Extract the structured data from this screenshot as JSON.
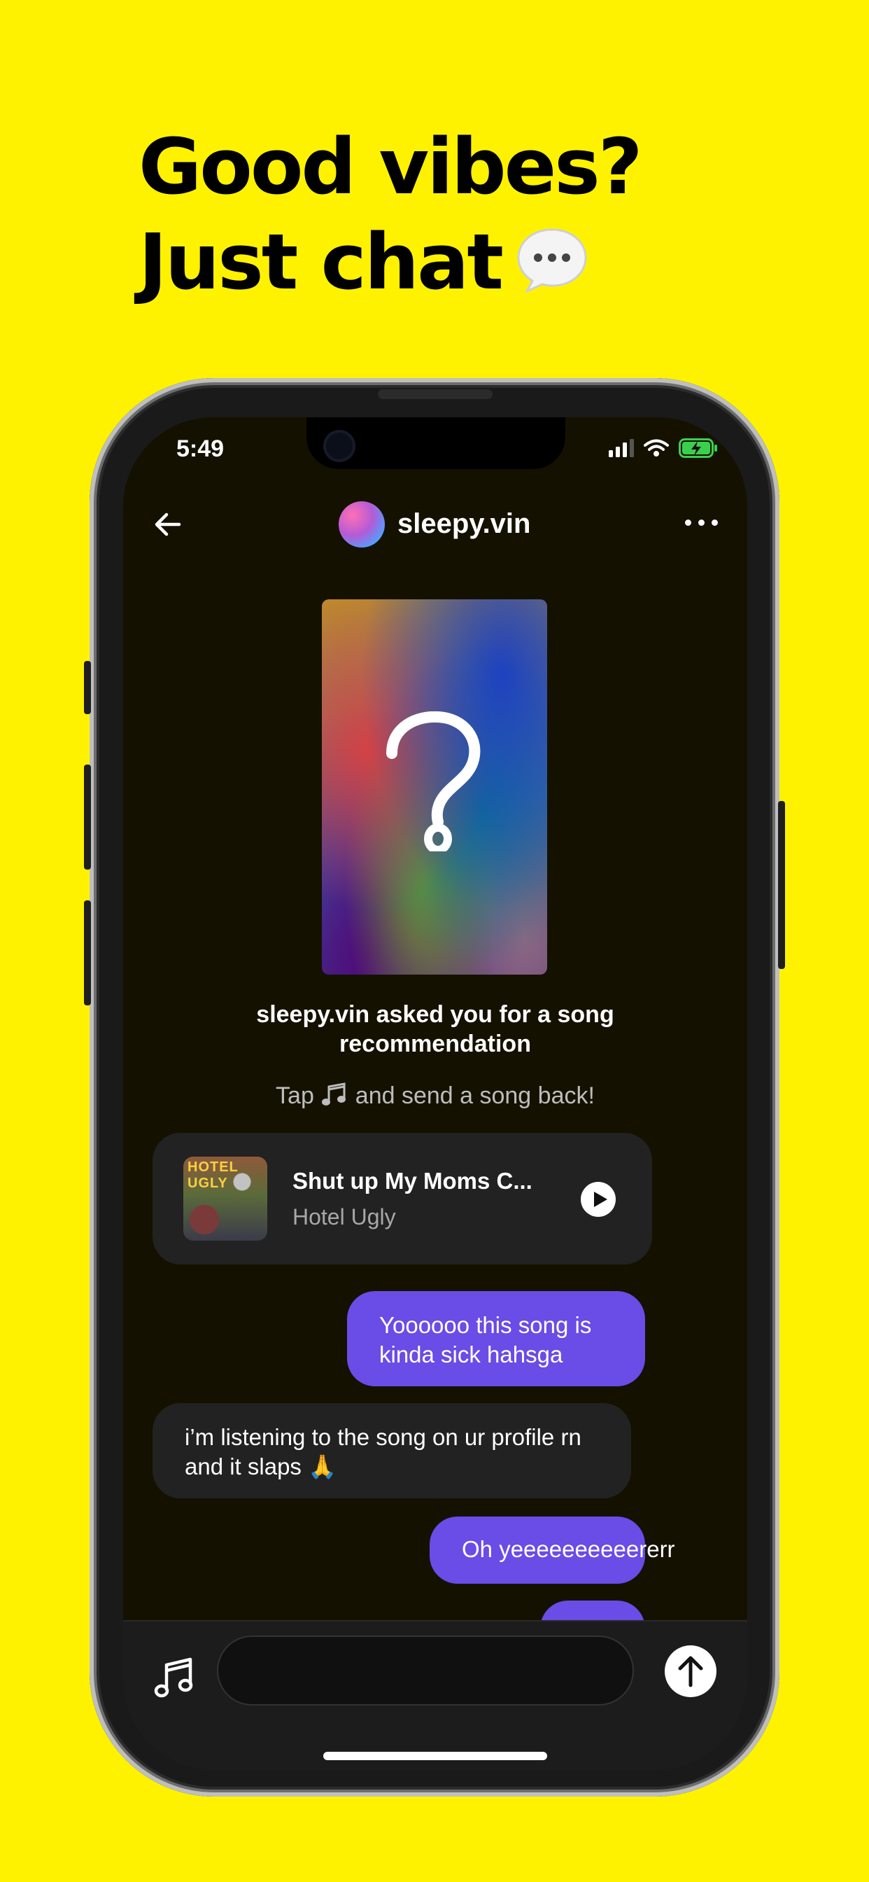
{
  "headline": {
    "line1": "Good vibes?",
    "line2": "Just chat",
    "line2_icon": "speech-bubble-icon"
  },
  "status_bar": {
    "time": "5:49",
    "icons": [
      "signal-icon",
      "wifi-icon",
      "battery-charging-icon"
    ]
  },
  "chat_header": {
    "username": "sleepy.vin",
    "back_icon": "back-arrow-icon",
    "more_icon": "more-dots-icon"
  },
  "question_card": {
    "icon": "question-mark-icon"
  },
  "request": {
    "message": "sleepy.vin asked you for a song recommendation",
    "hint_prefix": "Tap",
    "hint_icon": "music-note-icon",
    "hint_suffix": "and send a song back!"
  },
  "song_card": {
    "title": "Shut up My Moms C...",
    "artist": "Hotel Ugly",
    "album_art_text": "HOTEL UGLY",
    "play_icon": "play-icon"
  },
  "messages": [
    {
      "direction": "outgoing",
      "text": "Yoooooo this song is kinda sick hahsga"
    },
    {
      "direction": "incoming",
      "text": "i’m listening to the song on ur profile rn and it slaps 🙏"
    },
    {
      "direction": "outgoing",
      "text": "Oh yeeeeeeeeeererr"
    }
  ],
  "composer": {
    "music_icon": "music-notes-icon",
    "input_value": "",
    "send_icon": "send-arrow-icon"
  },
  "colors": {
    "background": "#FFF200",
    "outgoing_bubble": "#6A4CE6",
    "incoming_bubble": "#222222",
    "screen": "#151100"
  }
}
